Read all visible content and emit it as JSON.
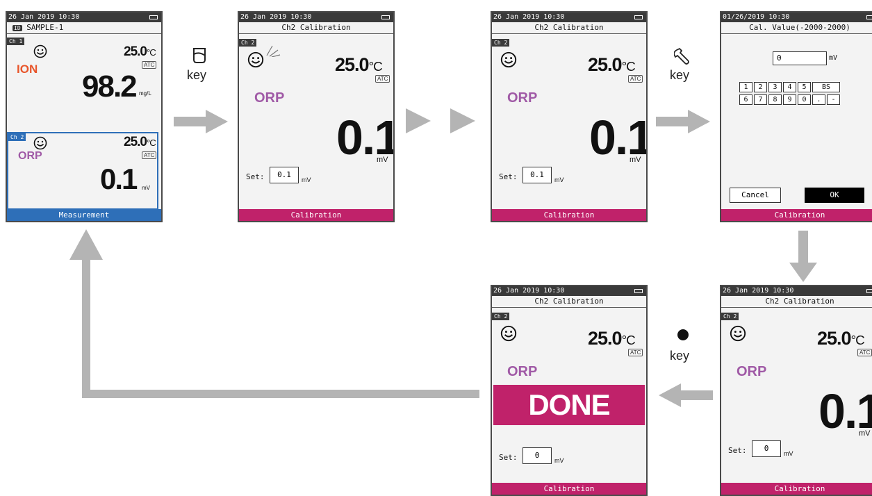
{
  "colors": {
    "calibration_bar": "#c0226a",
    "measurement_bar": "#2e6fb8",
    "ion": "#e8552a",
    "orp": "#a05aa6",
    "arrow": "#b4b4b4"
  },
  "screen1": {
    "datetime": "26 Jan 2019  10:30",
    "id_label": "ID",
    "sample": "SAMPLE-1",
    "ch1": "Ch 1",
    "ch1_temp": "25.0",
    "temp_unit": "°C",
    "atc": "ATC",
    "ch1_param": "ION",
    "ch1_value": "98.2",
    "ch1_unit": "mg/L",
    "ch2": "Ch 2",
    "ch2_temp": "25.0",
    "ch2_param": "ORP",
    "ch2_value": "0.1",
    "ch2_unit": "mV",
    "footer": "Measurement"
  },
  "key1": {
    "icon": "beaker-icon",
    "label": "key"
  },
  "screen2": {
    "datetime": "26 Jan 2019  10:30",
    "title": "Ch2 Calibration",
    "ch": "Ch 2",
    "temp": "25.0",
    "temp_unit": "°C",
    "atc": "ATC",
    "param": "ORP",
    "value": "0.1",
    "unit": "mV",
    "set_label": "Set:",
    "set_value": "0.1",
    "set_unit": "mV",
    "footer": "Calibration"
  },
  "screen3": {
    "datetime": "26 Jan 2019  10:30",
    "title": "Ch2 Calibration",
    "ch": "Ch 2",
    "temp": "25.0",
    "temp_unit": "°C",
    "atc": "ATC",
    "param": "ORP",
    "value": "0.1",
    "unit": "mV",
    "set_label": "Set:",
    "set_value": "0.1",
    "set_unit": "mV",
    "footer": "Calibration"
  },
  "key2": {
    "icon": "wrench-icon",
    "label": "key"
  },
  "screen4": {
    "datetime": "01/26/2019 10:30",
    "title": "Cal. Value(-2000-2000)",
    "input_value": "0",
    "input_unit": "mV",
    "keys_row1": [
      "1",
      "2",
      "3",
      "4",
      "5",
      "BS"
    ],
    "keys_row2": [
      "6",
      "7",
      "8",
      "9",
      "0",
      ".",
      "-"
    ],
    "cancel": "Cancel",
    "ok": "OK",
    "footer": "Calibration"
  },
  "screen5": {
    "datetime": "26 Jan 2019  10:30",
    "title": "Ch2 Calibration",
    "ch": "Ch 2",
    "temp": "25.0",
    "temp_unit": "°C",
    "atc": "ATC",
    "param": "ORP",
    "value": "0.1",
    "unit": "mV",
    "set_label": "Set:",
    "set_value": "0",
    "set_unit": "mV",
    "footer": "Calibration"
  },
  "key3": {
    "icon": "dot-icon",
    "label": "key"
  },
  "screen6": {
    "datetime": "26 Jan 2019  10:30",
    "title": "Ch2 Calibration",
    "ch": "Ch 2",
    "temp": "25.0",
    "temp_unit": "°C",
    "atc": "ATC",
    "param": "ORP",
    "done": "DONE",
    "set_label": "Set:",
    "set_value": "0",
    "set_unit": "mV",
    "footer": "Calibration"
  }
}
